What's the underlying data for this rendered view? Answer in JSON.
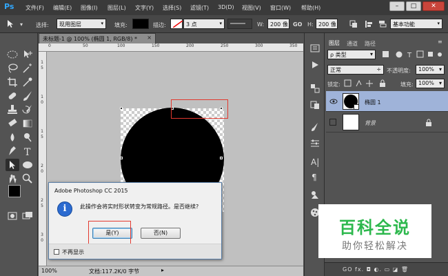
{
  "app": {
    "logo": "Ps"
  },
  "menu": [
    "文件(F)",
    "编辑(E)",
    "图像(I)",
    "图层(L)",
    "文字(Y)",
    "选择(S)",
    "滤镜(T)",
    "3D(D)",
    "视图(V)",
    "窗口(W)",
    "帮助(H)"
  ],
  "window_controls": {
    "minimize": "–",
    "restore": "□",
    "close": "✕"
  },
  "options": {
    "select_label": "选择:",
    "select_value": "现用图层",
    "fill_label": "填充:",
    "stroke_label": "描边:",
    "stroke_width": "3 点",
    "w_label": "W:",
    "w_value": "200 像",
    "link_icon": "GO",
    "h_label": "H:",
    "h_value": "200 像",
    "workspace": "基本功能"
  },
  "document": {
    "tab_title": "未标题-1 @ 100% (椭圆 1, RGB/8) *",
    "tab_close": "×",
    "ruler_h": [
      "0",
      "50",
      "100",
      "150",
      "200",
      "250",
      "300",
      "350"
    ],
    "ruler_v": [
      "1",
      "5",
      "1",
      "0",
      "1",
      "5",
      "2",
      "0",
      "2",
      "5",
      "3",
      "0"
    ],
    "status_zoom": "100%",
    "status_doc": "文档:117.2K/0 字节"
  },
  "dialog": {
    "title": "Adobe Photoshop CC 2015",
    "message": "此操作会将实时形状转变为常规路径。是否继续?",
    "icon_glyph": "i",
    "yes": "是(Y)",
    "no": "否(N)",
    "dont_show": "不再显示"
  },
  "layers_panel": {
    "tabs": [
      "图层",
      "通道",
      "路径"
    ],
    "filter": "ρ 类型",
    "blend_mode": "正常",
    "opacity_label": "不透明度:",
    "opacity_value": "100%",
    "lock_label": "锁定:",
    "fill_label": "填充:",
    "fill_value": "100%",
    "layers": [
      {
        "name": "椭圆 1",
        "selected": true
      },
      {
        "name": "背景",
        "selected": false
      }
    ],
    "footer": "GO  fx. ◘  ◐.  ▭  ◪  🗑"
  },
  "watermark": {
    "title": "百科全说",
    "subtitle": "助你轻松解决"
  },
  "colors": {
    "accent": "#31a8ff",
    "selection": "#9fb3d9",
    "watermark_green": "#2db84d",
    "highlight_red": "#e2382e"
  }
}
